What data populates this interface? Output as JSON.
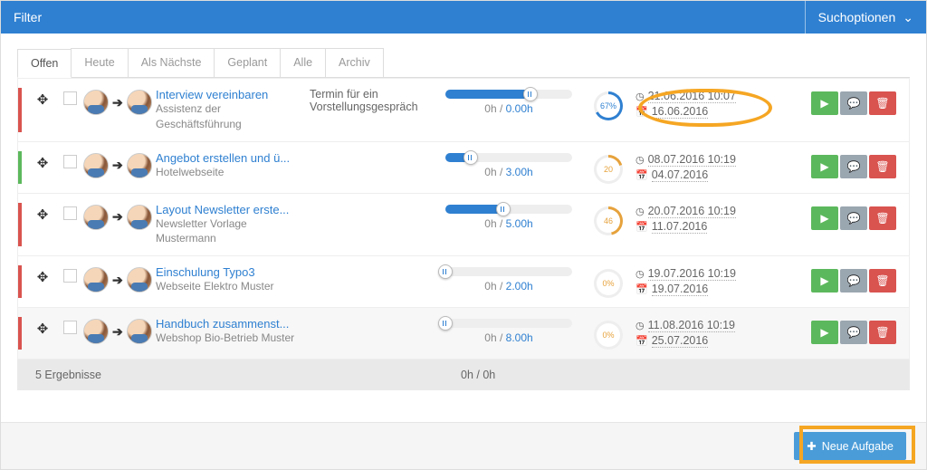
{
  "header": {
    "title": "Filter",
    "search_options": "Suchoptionen"
  },
  "tabs": [
    "Offen",
    "Heute",
    "Als Nächste",
    "Geplant",
    "Alle",
    "Archiv"
  ],
  "active_tab": 0,
  "tasks": [
    {
      "bar": "red",
      "title": "Interview vereinbaren",
      "subtitle": "Assistenz der Geschäftsführung",
      "description": "Termin für ein Vorstellungsgespräch",
      "progress_pct": 67,
      "progress_label": "67%",
      "ring_color": "#2f80d1",
      "hours_actual": "0h",
      "hours_est": "0.00h",
      "due_time": "21.06.2016 10:07",
      "due_date": "16.06.2016",
      "zebra": false
    },
    {
      "bar": "green",
      "title": "Angebot erstellen und ü...",
      "subtitle": "Hotelwebseite",
      "description": "",
      "progress_pct": 20,
      "progress_label": "20",
      "ring_color": "#e6a23c",
      "hours_actual": "0h",
      "hours_est": "3.00h",
      "due_time": "08.07.2016 10:19",
      "due_date": "04.07.2016",
      "zebra": false
    },
    {
      "bar": "red",
      "title": "Layout Newsletter erste...",
      "subtitle": "Newsletter Vorlage Mustermann",
      "description": "",
      "progress_pct": 46,
      "progress_label": "46",
      "ring_color": "#e6a23c",
      "hours_actual": "0h",
      "hours_est": "5.00h",
      "due_time": "20.07.2016 10:19",
      "due_date": "11.07.2016",
      "zebra": false
    },
    {
      "bar": "red",
      "title": "Einschulung Typo3",
      "subtitle": "Webseite Elektro Muster",
      "description": "",
      "progress_pct": 0,
      "progress_label": "0%",
      "ring_color": "#e6a23c",
      "hours_actual": "0h",
      "hours_est": "2.00h",
      "due_time": "19.07.2016 10:19",
      "due_date": "19.07.2016",
      "zebra": false
    },
    {
      "bar": "red",
      "title": "Handbuch zusammenst...",
      "subtitle": "Webshop Bio-Betrieb Muster",
      "description": "",
      "progress_pct": 0,
      "progress_label": "0%",
      "ring_color": "#e6a23c",
      "hours_actual": "0h",
      "hours_est": "8.00h",
      "due_time": "11.08.2016 10:19",
      "due_date": "25.07.2016",
      "zebra": true
    }
  ],
  "summary": {
    "results": "5 Ergebnisse",
    "hours": "0h / 0h"
  },
  "buttons": {
    "new_task": "Neue Aufgabe"
  },
  "icons": {
    "play": "▶",
    "comment": "💬",
    "trash": "🗑",
    "clock": "◷",
    "calendar": "📅",
    "plus": "✚",
    "chevron": "⌄",
    "move": "✥",
    "arrow": "➔"
  }
}
